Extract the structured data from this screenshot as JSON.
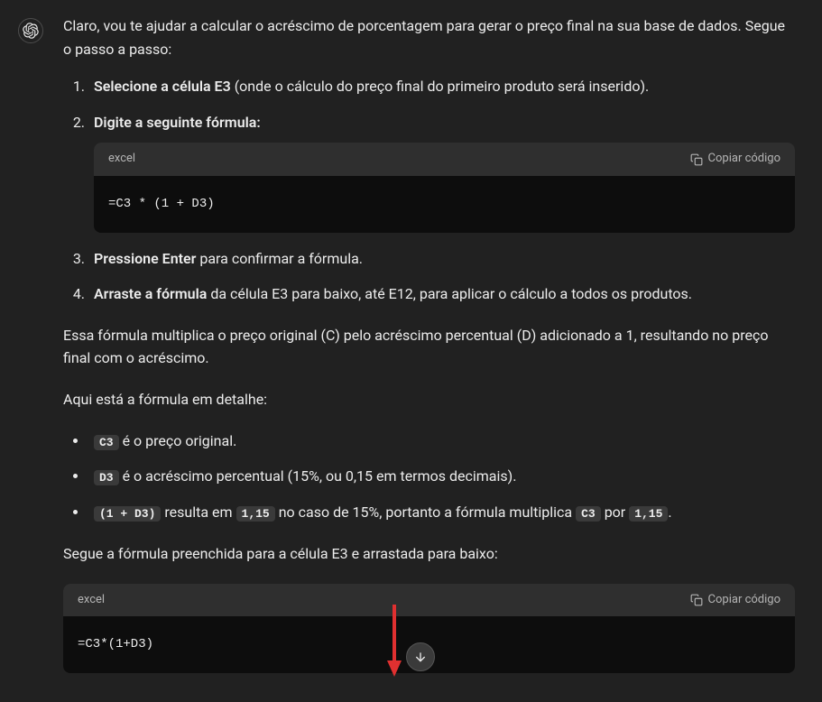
{
  "intro": "Claro, vou te ajudar a calcular o acréscimo de porcentagem para gerar o preço final na sua base de dados. Segue o passo a passo:",
  "steps": {
    "s1_bold": "Selecione a célula E3",
    "s1_rest": " (onde o cálculo do preço final do primeiro produto será inserido).",
    "s2_bold": "Digite a seguinte fórmula:",
    "s3_bold": "Pressione Enter",
    "s3_rest": " para confirmar a fórmula.",
    "s4_bold": "Arraste a fórmula",
    "s4_rest": " da célula E3 para baixo, até E12, para aplicar o cálculo a todos os produtos."
  },
  "code1": {
    "lang": "excel",
    "copy": "Copiar código",
    "content": "=C3 * (1 + D3)"
  },
  "para1": "Essa fórmula multiplica o preço original (C) pelo acréscimo percentual (D) adicionado a 1, resultando no preço final com o acréscimo.",
  "para2": "Aqui está a fórmula em detalhe:",
  "bullets": {
    "b1_code": "C3",
    "b1_text": " é o preço original.",
    "b2_code": "D3",
    "b2_text": " é o acréscimo percentual (15%, ou 0,15 em termos decimais).",
    "b3_code1": "(1 + D3)",
    "b3_text1": " resulta em ",
    "b3_code2": "1,15",
    "b3_text2": " no caso de 15%, portanto a fórmula multiplica ",
    "b3_code3": "C3",
    "b3_text3": " por ",
    "b3_code4": "1,15",
    "b3_text4": "."
  },
  "para3": "Segue a fórmula preenchida para a célula E3 e arrastada para baixo:",
  "code2": {
    "lang": "excel",
    "copy": "Copiar código",
    "content": "=C3*(1+D3)"
  }
}
